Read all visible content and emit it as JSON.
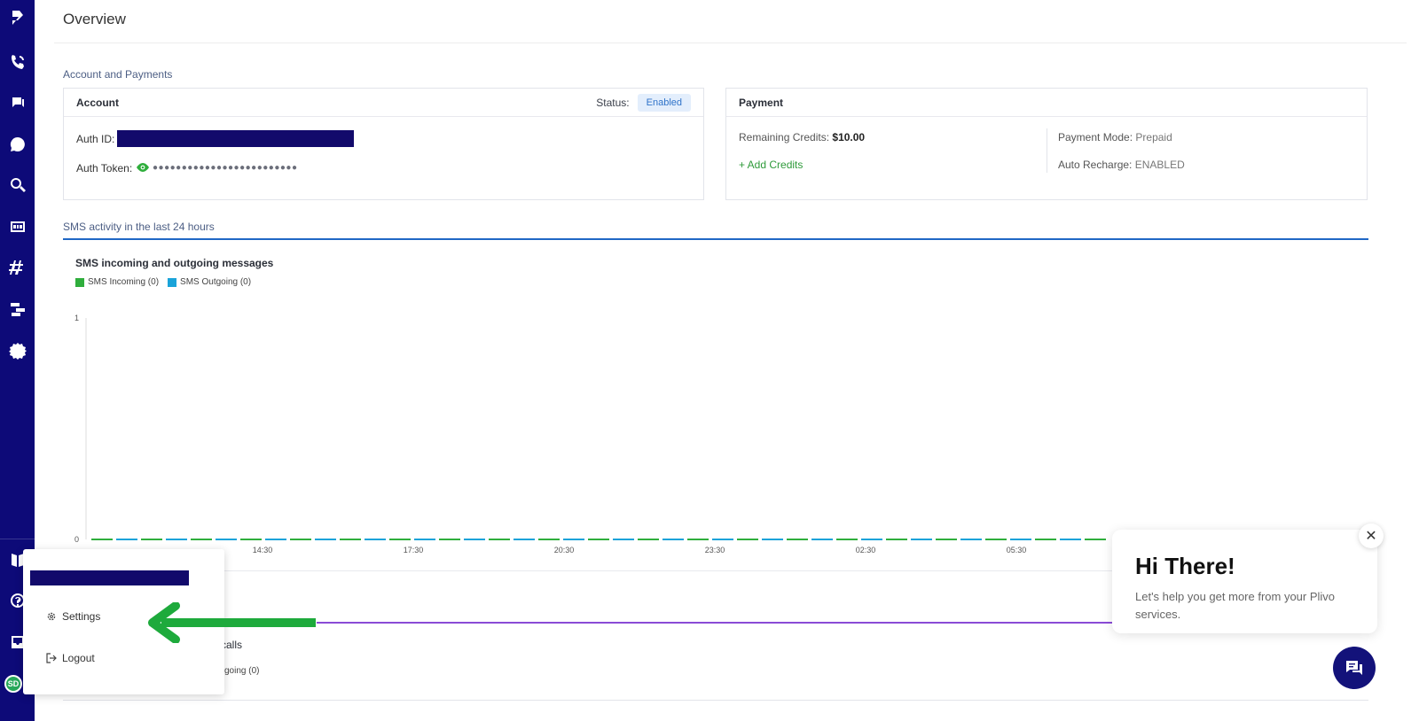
{
  "page": {
    "title": "Overview"
  },
  "sections": {
    "account_payments": "Account and Payments",
    "sms_activity": "SMS activity in the last 24 hours"
  },
  "account": {
    "heading": "Account",
    "status_label": "Status:",
    "status_value": "Enabled",
    "auth_id_label": "Auth ID:",
    "auth_token_label": "Auth Token:",
    "auth_token_masked": "●●●●●●●●●●●●●●●●●●●●●●●●●"
  },
  "payment": {
    "heading": "Payment",
    "remaining_credits_label": "Remaining Credits:",
    "remaining_credits_value": "$10.00",
    "add_credits": "+ Add Credits",
    "payment_mode_label": "Payment Mode:",
    "payment_mode_value": "Prepaid",
    "auto_recharge_label": "Auto Recharge:",
    "auto_recharge_value": "ENABLED"
  },
  "chart_data": {
    "type": "line",
    "title": "SMS incoming and outgoing messages",
    "categories": [
      "14:30",
      "17:30",
      "20:30",
      "23:30",
      "02:30",
      "05:30"
    ],
    "series": [
      {
        "name": "SMS Incoming (0)",
        "color": "#2fae3c",
        "values": [
          0,
          0,
          0,
          0,
          0,
          0
        ]
      },
      {
        "name": "SMS Outgoing (0)",
        "color": "#1aa3d9",
        "values": [
          0,
          0,
          0,
          0,
          0,
          0
        ]
      }
    ],
    "ylim": [
      0,
      1
    ],
    "yticks": [
      "1",
      "0"
    ]
  },
  "calls_fragment": {
    "title_tail": "calls",
    "legend_tail": "going (0)"
  },
  "user_menu": {
    "settings": "Settings",
    "logout": "Logout"
  },
  "chat": {
    "title": "Hi There!",
    "body": "Let's help you get more from your Plivo services.",
    "close": "✕"
  },
  "avatar": {
    "initials": "SD"
  },
  "colors": {
    "sidebar": "#0d0a78",
    "accent_green": "#2e9a3a",
    "accent_blue": "#2067c5",
    "redact": "#120a6b"
  }
}
